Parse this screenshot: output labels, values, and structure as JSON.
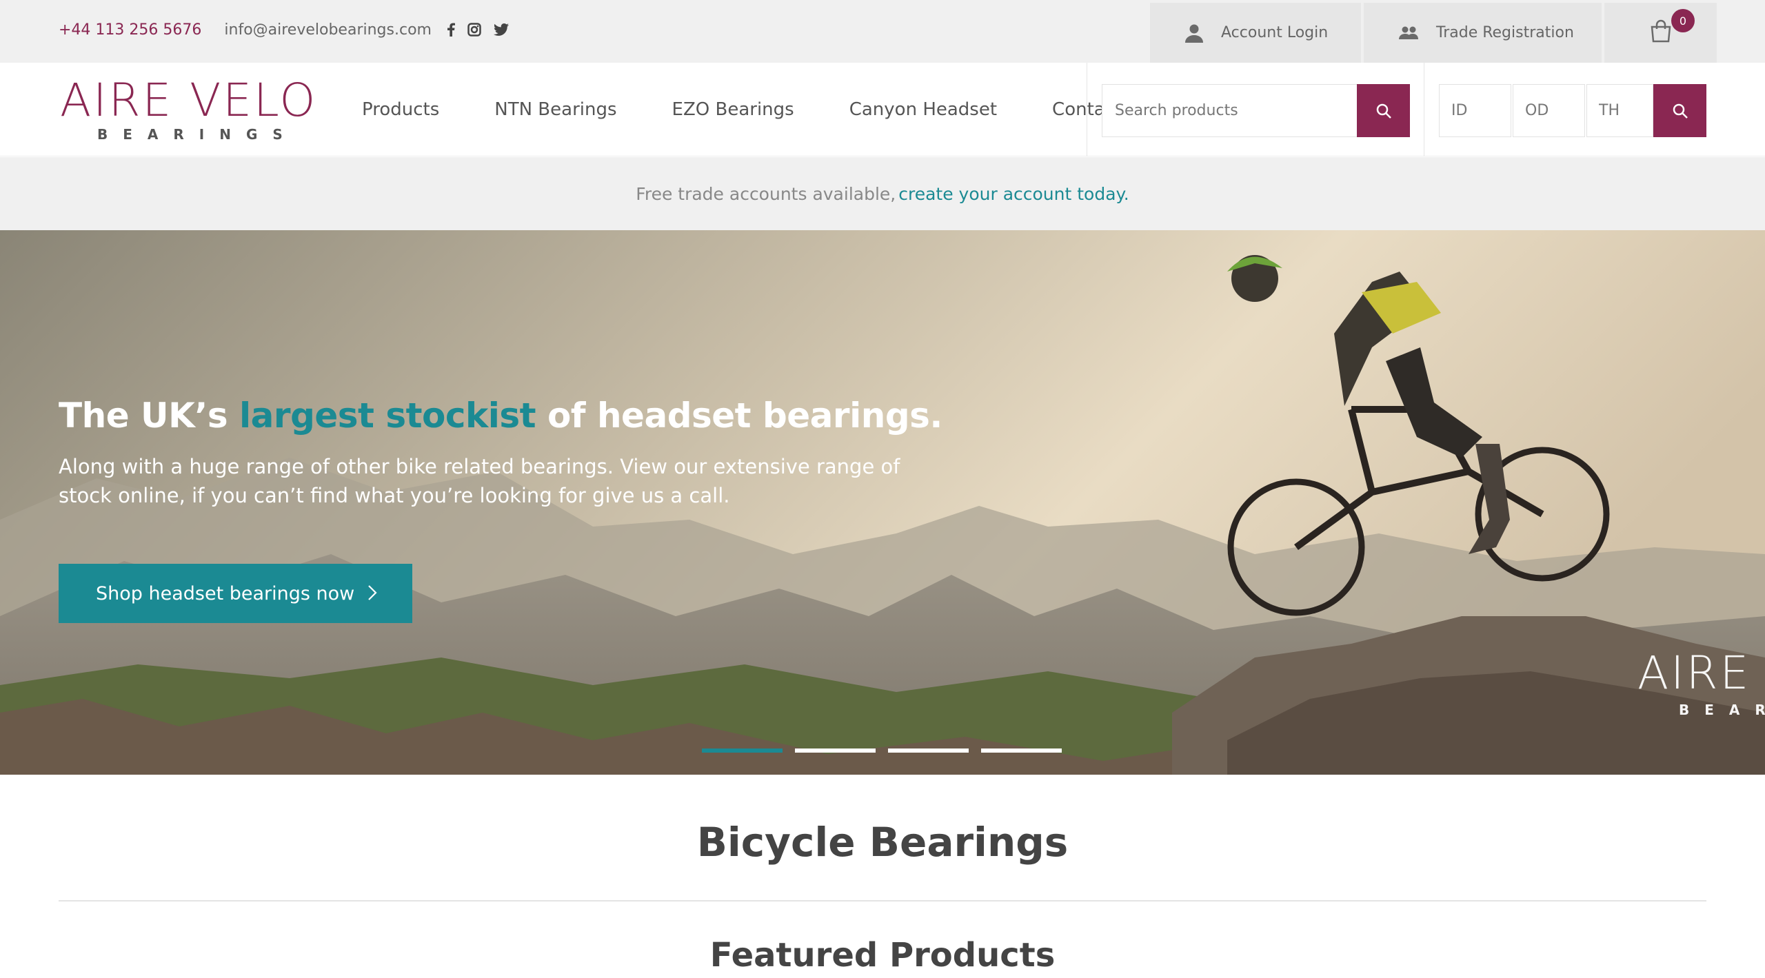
{
  "topbar": {
    "phone": "+44 113 256 5676",
    "email": "info@airevelobearings.com",
    "social": [
      "facebook-icon",
      "instagram-icon",
      "twitter-icon"
    ],
    "account_login": "Account Login",
    "trade_registration": "Trade Registration",
    "cart_count": "0"
  },
  "header": {
    "logo_main": "AIRE VELO",
    "logo_sub": "BEARINGS",
    "nav": [
      "Products",
      "NTN Bearings",
      "EZO Bearings",
      "Canyon Headset",
      "Contact"
    ],
    "search_placeholder": "Search products",
    "dim_id_placeholder": "ID",
    "dim_od_placeholder": "OD",
    "dim_th_placeholder": "TH"
  },
  "trade_banner": {
    "text": "Free trade accounts available,",
    "link": "create your account today."
  },
  "hero": {
    "title_start": "The UK’s ",
    "title_highlight": "largest stockist",
    "title_end": " of headset bearings.",
    "body": "Along with a huge range of other bike related bearings. View our extensive range of stock online, if you can’t find what you’re looking for give us a call.",
    "cta": "Shop headset bearings now",
    "slides": 4,
    "active_slide": 1,
    "watermark_main": "AIRE",
    "watermark_sub": "BEAR"
  },
  "sections": {
    "title": "Bicycle Bearings",
    "featured": "Featured Products"
  },
  "colors": {
    "brand": "#8a2752",
    "accent": "#1b8a93"
  }
}
